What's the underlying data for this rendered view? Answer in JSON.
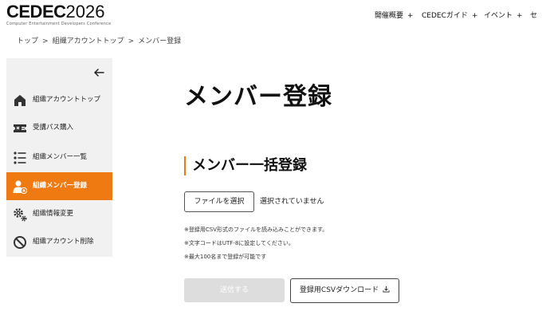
{
  "header": {
    "logo_text": "CEDEC",
    "logo_year": "2026",
    "logo_tagline": "Computer Entertainment Developers Conference",
    "nav": [
      {
        "label": "開催概要",
        "plus": "+"
      },
      {
        "label": "CEDECガイド",
        "plus": "+"
      },
      {
        "label": "イベント",
        "plus": "+"
      },
      {
        "label": "セ",
        "plus": ""
      }
    ]
  },
  "breadcrumb": {
    "items": [
      "トップ",
      "組織アカウントトップ",
      "メンバー登録"
    ],
    "separator": ">"
  },
  "sidebar": {
    "back_icon": "arrow-left-icon",
    "items": [
      {
        "label": "組織アカウントトップ",
        "icon": "home-icon",
        "active": false
      },
      {
        "label": "受講パス購入",
        "icon": "ticket-icon",
        "active": false
      },
      {
        "label": "組織メンバー一覧",
        "icon": "list-icon",
        "active": false
      },
      {
        "label": "組織メンバー登録",
        "icon": "user-add-icon",
        "active": true
      },
      {
        "label": "組織情報変更",
        "icon": "gears-icon",
        "active": false
      },
      {
        "label": "組織アカウント削除",
        "icon": "prohibited-icon",
        "active": false
      }
    ]
  },
  "main": {
    "page_title": "メンバー登録",
    "section_title": "メンバー一括登録",
    "file_button_label": "ファイルを選択",
    "file_status": "選択されていません",
    "notes": [
      "※登録用CSV形式のファイルを読み込みことができます。",
      "※文字コードはUTF-8に設定してください。",
      "※最大100名まで登録が可能です"
    ],
    "submit_label": "送信する",
    "download_label": "登録用CSVダウンロード",
    "download_icon": "download-icon"
  },
  "colors": {
    "accent": "#ef7a12",
    "sidebar_bg": "#f1f1f1",
    "disabled_button": "#dddddd"
  }
}
